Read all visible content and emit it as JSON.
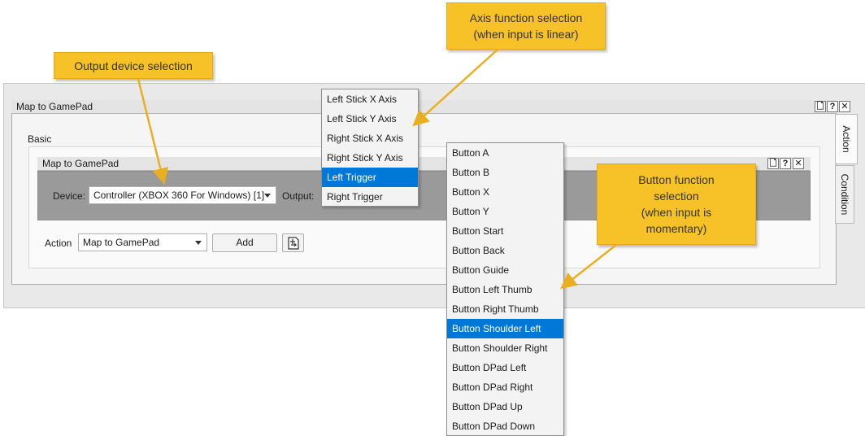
{
  "outer_panel": {
    "title": "Map to GamePad",
    "buttons": [
      "🗋",
      "?",
      "✕"
    ]
  },
  "tabs": [
    "Action",
    "Condition"
  ],
  "basic_label": "Basic",
  "inner_panel": {
    "title": "Map to GamePad",
    "buttons": [
      "🗋",
      "?",
      "✕"
    ]
  },
  "device": {
    "label": "Device:",
    "value": "Controller (XBOX 360 For Windows) [1]"
  },
  "output": {
    "label": "Output:"
  },
  "action": {
    "label": "Action",
    "value": "Map to GamePad",
    "add_label": "Add"
  },
  "axis_menu": {
    "items": [
      "Left Stick X Axis",
      "Left Stick Y Axis",
      "Right Stick X Axis",
      "Right Stick Y Axis",
      "Left Trigger",
      "Right Trigger"
    ],
    "selected": "Left Trigger"
  },
  "button_menu": {
    "items": [
      "Button A",
      "Button B",
      "Button X",
      "Button Y",
      "Button Start",
      "Button Back",
      "Button Guide",
      "Button Left Thumb",
      "Button Right Thumb",
      "Button Shoulder Left",
      "Button Shoulder Right",
      "Button DPad Left",
      "Button DPad Right",
      "Button DPad Up",
      "Button DPad Down"
    ],
    "selected": "Button Shoulder Left"
  },
  "callouts": {
    "output_device": "Output device selection",
    "axis_function": "Axis function selection\n(when input is linear)",
    "button_function": "Button function\nselection\n(when input is\nmomentary)"
  },
  "colors": {
    "callout": "#f7c128",
    "selection": "#0078d7",
    "arrow": "#e8b020"
  }
}
